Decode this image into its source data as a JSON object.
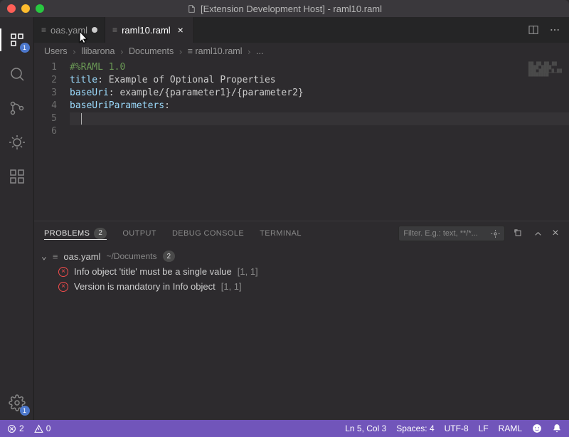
{
  "title_bar": {
    "title": "[Extension Development Host] - raml10.raml"
  },
  "activity": {
    "explorer_badge": "1",
    "settings_badge": "1"
  },
  "tabs": [
    {
      "icon": "≡",
      "label": "oas.yaml",
      "modified": true,
      "active": false
    },
    {
      "icon": "≡",
      "label": "raml10.raml",
      "modified": false,
      "active": true
    }
  ],
  "breadcrumbs": {
    "parts": [
      "Users",
      "llibarona",
      "Documents",
      "≡ raml10.raml",
      "..."
    ]
  },
  "code_lines": [
    {
      "n": "1",
      "html": "<span class='comment'>#%RAML 1.0</span>"
    },
    {
      "n": "2",
      "html": "<span class='prop'>title</span>: Example of Optional Properties"
    },
    {
      "n": "3",
      "html": "<span class='prop'>baseUri</span>: example/{parameter1}/{parameter2}"
    },
    {
      "n": "4",
      "html": "<span class='prop'>baseUriParameters</span>:"
    },
    {
      "n": "5",
      "html": "  <span class='cursor'></span>",
      "current": true
    },
    {
      "n": "6",
      "html": ""
    }
  ],
  "panel": {
    "tabs": {
      "problems": "PROBLEMS",
      "problems_count": "2",
      "output": "OUTPUT",
      "debug_console": "DEBUG CONSOLE",
      "terminal": "TERMINAL"
    },
    "filter_placeholder": "Filter. E.g.: text, **/*...",
    "file": {
      "name": "oas.yaml",
      "path": "~/Documents",
      "count": "2"
    },
    "problems": [
      {
        "msg": "Info object 'title' must be a single value",
        "pos": "[1, 1]"
      },
      {
        "msg": "Version is mandatory in Info object",
        "pos": "[1, 1]"
      }
    ]
  },
  "status": {
    "errors": "2",
    "warnings": "0",
    "ln_col": "Ln 5, Col 3",
    "spaces": "Spaces: 4",
    "encoding": "UTF-8",
    "eol": "LF",
    "lang": "RAML"
  }
}
